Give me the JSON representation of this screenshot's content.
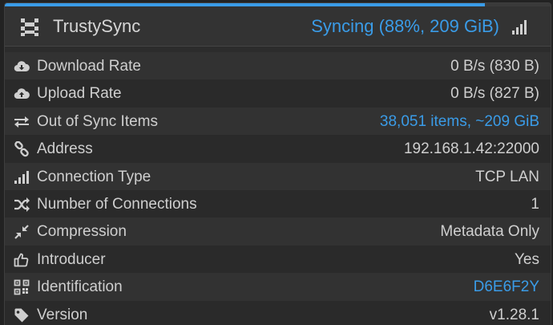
{
  "device": {
    "name": "TrustySync",
    "status": "Syncing (88%, 209 GiB)",
    "sync_progress_percent": 88,
    "icon": "device-icon",
    "accent_color": "#3a9ce8"
  },
  "rows": [
    {
      "icon": "cloud-download-icon",
      "label": "Download Rate",
      "value": "0 B/s (830 B)"
    },
    {
      "icon": "cloud-upload-icon",
      "label": "Upload Rate",
      "value": "0 B/s (827 B)"
    },
    {
      "icon": "exchange-arrows-icon",
      "label": "Out of Sync Items",
      "value": "38,051 items, ~209 GiB"
    },
    {
      "icon": "link-icon",
      "label": "Address",
      "value": "192.168.1.42:22000"
    },
    {
      "icon": "signal-bars-icon",
      "label": "Connection Type",
      "value": "TCP LAN"
    },
    {
      "icon": "shuffle-icon",
      "label": "Number of Connections",
      "value": "1"
    },
    {
      "icon": "compress-icon",
      "label": "Compression",
      "value": "Metadata Only"
    },
    {
      "icon": "thumbs-up-icon",
      "label": "Introducer",
      "value": "Yes"
    },
    {
      "icon": "qrcode-icon",
      "label": "Identification",
      "value": "D6E6F2Y"
    },
    {
      "icon": "tag-icon",
      "label": "Version",
      "value": "v1.28.1"
    }
  ]
}
